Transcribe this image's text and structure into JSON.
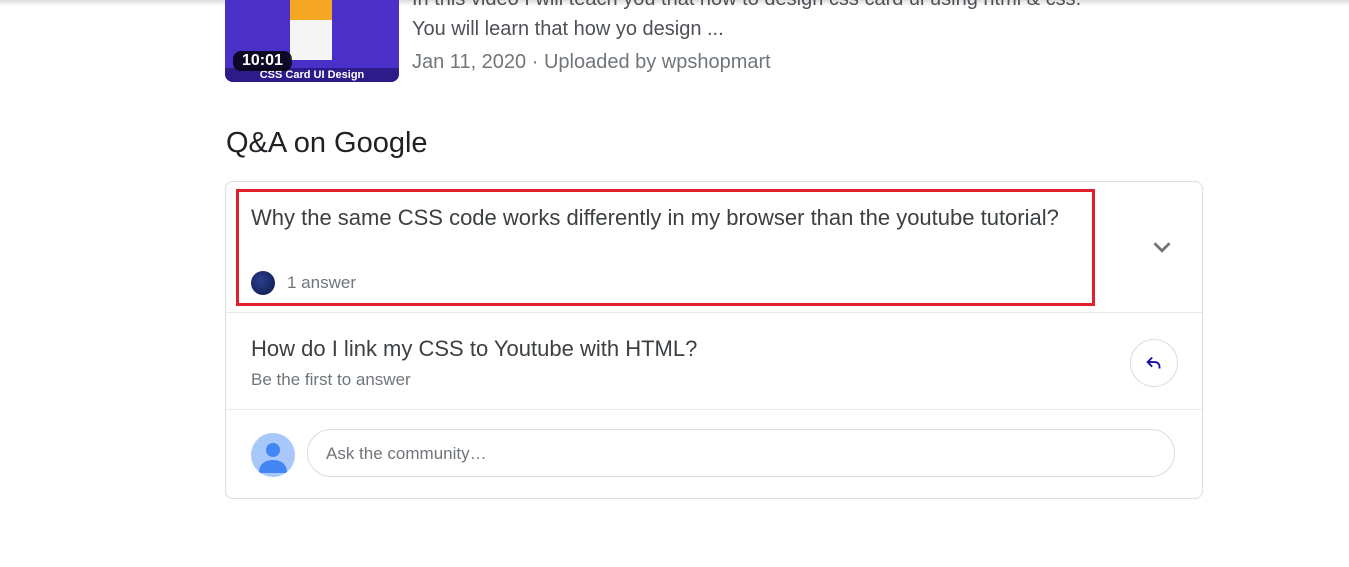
{
  "video": {
    "duration": "10:01",
    "thumb_caption": "CSS Card UI Design",
    "desc_line1": "In this video I will teach you that how to design css card ui using html & css.",
    "desc_line2": "You will learn that how yo design ...",
    "meta": "Jan 11, 2020 · Uploaded by wpshopmart"
  },
  "qa": {
    "title": "Q&A on Google",
    "questions": [
      {
        "text": "Why the same CSS code works differently in my browser than the youtube tutorial?",
        "sub": "1 answer"
      },
      {
        "text": "How do I link my CSS to Youtube with HTML?",
        "sub": "Be the first to answer"
      }
    ],
    "ask_placeholder": "Ask the community…"
  }
}
